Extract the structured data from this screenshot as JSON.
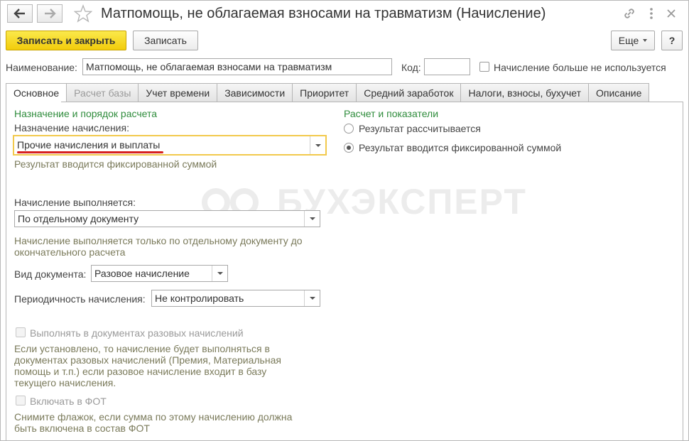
{
  "window": {
    "title": "Матпомощь, не облагаемая взносами на травматизм (Начисление)",
    "back_icon": "arrow-left-icon",
    "forward_icon": "arrow-right-icon",
    "favorite_icon": "star-icon",
    "link_icon": "link-icon",
    "menu_icon": "more-vertical-icon",
    "close_icon": "close-icon"
  },
  "toolbar": {
    "save_close_label": "Записать и закрыть",
    "save_label": "Записать",
    "more_label": "Еще",
    "help_label": "?"
  },
  "header": {
    "name_label": "Наименование:",
    "name_value": "Матпомощь, не облагаемая взносами на травматизм",
    "code_label": "Код:",
    "code_value": "",
    "unused_label": "Начисление больше не используется",
    "unused_checked": false
  },
  "tabs": [
    {
      "label": "Основное",
      "state": "active"
    },
    {
      "label": "Расчет базы",
      "state": "disabled"
    },
    {
      "label": "Учет времени",
      "state": "normal"
    },
    {
      "label": "Зависимости",
      "state": "normal"
    },
    {
      "label": "Приоритет",
      "state": "normal"
    },
    {
      "label": "Средний заработок",
      "state": "normal"
    },
    {
      "label": "Налоги, взносы, бухучет",
      "state": "normal"
    },
    {
      "label": "Описание",
      "state": "normal"
    }
  ],
  "left": {
    "section_title": "Назначение и порядок расчета",
    "purpose_label": "Назначение начисления:",
    "purpose_value": "Прочие начисления и выплаты",
    "purpose_hint": "Результат вводится фиксированной суммой",
    "exec_label": "Начисление выполняется:",
    "exec_value": "По отдельному документу",
    "exec_hint_1": "Начисление выполняется только по отдельному документу до",
    "exec_hint_2": "окончательного расчета",
    "doc_type_label": "Вид документа:",
    "doc_type_value": "Разовое начисление",
    "periodicity_label": "Периодичность начисления:",
    "periodicity_value": "Не контролировать",
    "onetime_checkbox_label": "Выполнять в документах разовых начислений",
    "onetime_hint_1": "Если установлено, то начисление будет выполняться в",
    "onetime_hint_2": "документах разовых начислений (Премия, Материальная",
    "onetime_hint_3": "помощь и т.п.) если разовое начисление входит в базу",
    "onetime_hint_4": "текущего начисления.",
    "fot_checkbox_label": "Включать в ФОТ",
    "fot_hint_1": "Снимите флажок, если сумма по этому начислению должна",
    "fot_hint_2": "быть включена в состав ФОТ"
  },
  "right": {
    "section_title": "Расчет и показатели",
    "radio_calc_label": "Результат рассчитывается",
    "radio_fixed_label": "Результат вводится фиксированной суммой",
    "selected": "fixed"
  },
  "watermark": "БУХЭКСПЕРТ",
  "colors": {
    "primary_button": "#f2cc0b",
    "section_title": "#2f8c3c",
    "focus_border": "#f2c94c",
    "underline_mark": "#d62020"
  }
}
